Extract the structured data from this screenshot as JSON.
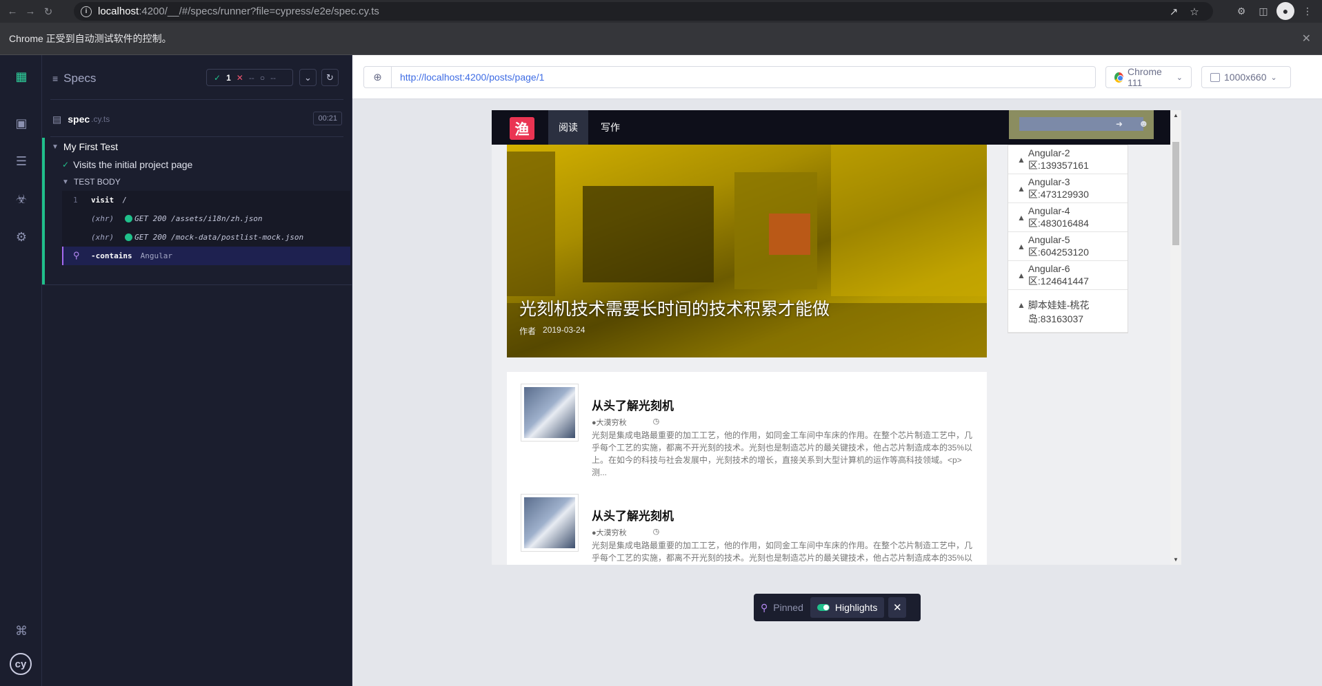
{
  "browser": {
    "url_host": "localhost",
    "url_path": ":4200/__/#/specs/runner?file=cypress/e2e/spec.cy.ts",
    "infobar_text": "Chrome 正受到自动测试软件的控制。"
  },
  "reporter": {
    "header_title": "Specs",
    "stats": {
      "passed": "1",
      "failed": "--",
      "pending": "--"
    },
    "spec_name": "spec",
    "spec_ext": ".cy.ts",
    "duration": "00:21",
    "suite_title": "My First Test",
    "test_title": "Visits the initial project page",
    "test_body_label": "TEST BODY",
    "commands": [
      {
        "num": "1",
        "name": "visit",
        "message": "/"
      },
      {
        "xhr": "(xhr)",
        "message": "GET 200 /assets/i18n/zh.json"
      },
      {
        "xhr": "(xhr)",
        "message": "GET 200 /mock-data/postlist-mock.json"
      },
      {
        "name": "-contains",
        "message": "Angular"
      }
    ]
  },
  "aut": {
    "url": "http://localhost:4200/posts/page/1",
    "browser_label": "Chrome 111",
    "viewport_label": "1000x660"
  },
  "app": {
    "logo_text": "渔",
    "nav_read": "阅读",
    "nav_write": "写作",
    "hero_title": "光刻机技术需要长时间的技术积累才能做",
    "hero_author": "作者",
    "hero_date": "2019-03-24",
    "posts": [
      {
        "title": "从头了解光刻机",
        "author": "大漠穷秋",
        "excerpt": "光刻是集成电路最重要的加工工艺，他的作用，如同金工车间中车床的作用。在整个芯片制造工艺中，几乎每个工艺的实施，都离不开光刻的技术。光刻也是制造芯片的最关键技术，他占芯片制造成本的35%以上。在如今的科技与社会发展中，光刻技术的增长，直接关系到大型计算机的运作等高科技领域。<p>测..."
      },
      {
        "title": "从头了解光刻机",
        "author": "大漠穷秋",
        "excerpt": "光刻是集成电路最重要的加工工艺，他的作用，如同金工车间中车床的作用。在整个芯片制造工艺中，几乎每个工艺的实施，都离不开光刻的技术。光刻也是制造芯片的最关键技术，他占芯片制造成本的35%以上。在如今的科技与社会发展中，光刻技术的增长，直接关系到大型计算机的"
      }
    ],
    "qq_groups": [
      "Angular-2区:139357161",
      "Angular-3区:473129930",
      "Angular-4区:483016484",
      "Angular-5区:604253120",
      "Angular-6区:124641447",
      "脚本娃娃-桃花岛:83163037"
    ]
  },
  "pinned_bar": {
    "pinned_label": "Pinned",
    "highlights_label": "Highlights"
  },
  "colors": {
    "reporter_bg": "#1b1e2e",
    "pass": "#20c08b",
    "fail": "#ef5570",
    "url_blue": "#3e6ce4",
    "logo_red": "#ea3452"
  }
}
